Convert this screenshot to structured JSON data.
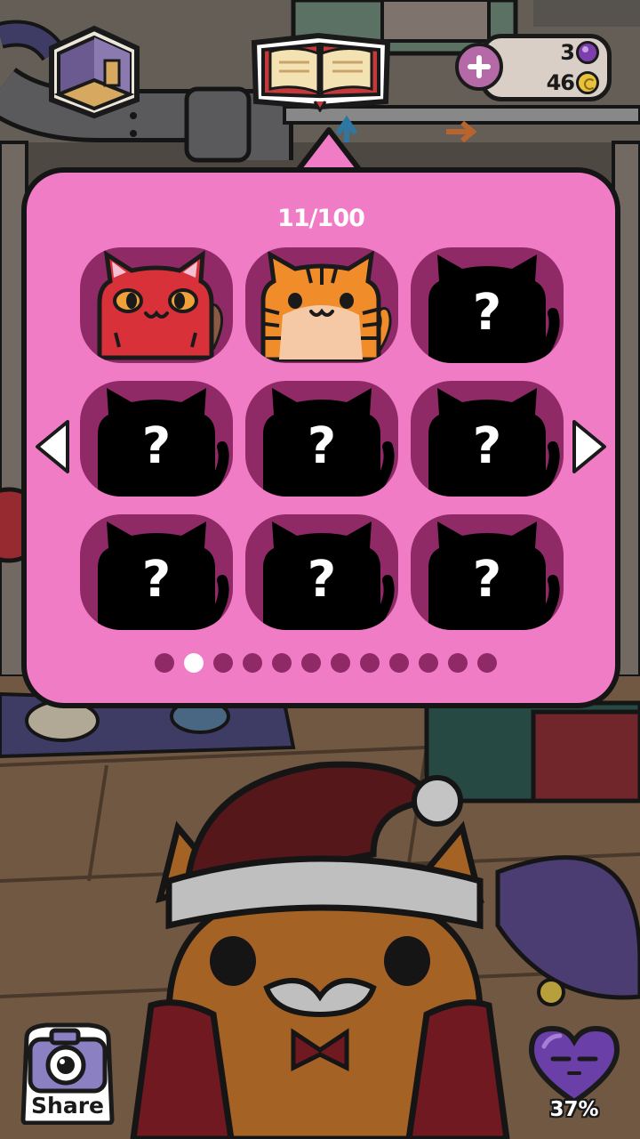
{
  "hud": {
    "gems": "3",
    "coins": "46"
  },
  "collection": {
    "count_label": "11/100",
    "slots": [
      {
        "state": "unlocked",
        "cat": "red-cat"
      },
      {
        "state": "unlocked",
        "cat": "tiger-cat"
      },
      {
        "state": "locked",
        "symbol": "?"
      },
      {
        "state": "locked",
        "symbol": "?"
      },
      {
        "state": "locked",
        "symbol": "?"
      },
      {
        "state": "locked",
        "symbol": "?"
      },
      {
        "state": "locked",
        "symbol": "?"
      },
      {
        "state": "locked",
        "symbol": "?"
      },
      {
        "state": "locked",
        "symbol": "?"
      }
    ],
    "page_count": 12,
    "current_page": 2
  },
  "bottom": {
    "share_label": "Share",
    "mood_label": "37%",
    "mood_value": 0.37
  },
  "icons": {
    "room": "room-view-icon",
    "book": "cat-book-icon",
    "plus": "plus-icon",
    "gem": "gem-icon",
    "coin": "coin-icon",
    "camera": "camera-icon",
    "heart": "heart-mood-icon"
  },
  "colors": {
    "panel": "#f07cc6",
    "slot": "#8f2a67",
    "outline": "#151515"
  }
}
